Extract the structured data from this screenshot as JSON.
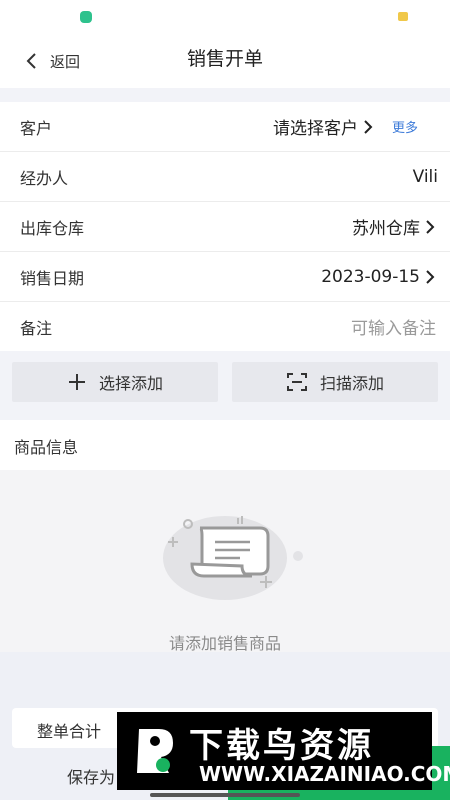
{
  "header": {
    "back_label": "返回",
    "title": "销售开单"
  },
  "form": {
    "customer": {
      "label": "客户",
      "value": "请选择客户",
      "more": "更多"
    },
    "handler": {
      "label": "经办人",
      "value": "Vili"
    },
    "warehouse": {
      "label": "出库仓库",
      "value": "苏州仓库"
    },
    "sale_date": {
      "label": "销售日期",
      "value": "2023-09-15"
    },
    "remark": {
      "label": "备注",
      "placeholder": "可输入备注"
    }
  },
  "actions": {
    "select_add": "选择添加",
    "scan_add": "扫描添加"
  },
  "goods": {
    "title": "商品信息",
    "empty_text": "请添加销售商品"
  },
  "footer": {
    "total_label": "整单合计",
    "save_label": "保存为"
  },
  "watermark": {
    "title": "下载鸟资源",
    "url": "WWW.XIAZAINIAO.COM"
  },
  "colors": {
    "accent_green": "#19b25f",
    "link_blue": "#3d7bd9",
    "page_bg": "#f2f3f8"
  },
  "icons": [
    "chevron-left-icon",
    "chevron-right-icon",
    "plus-icon",
    "scan-icon",
    "empty-receipt-icon"
  ]
}
